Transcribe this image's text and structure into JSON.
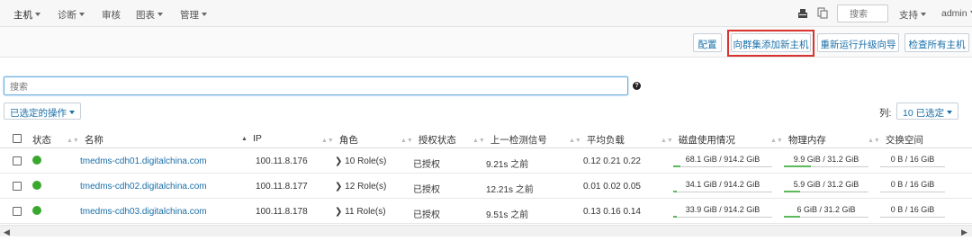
{
  "nav": {
    "items": [
      {
        "label": "主机",
        "dropdown": true
      },
      {
        "label": "诊断",
        "dropdown": true
      },
      {
        "label": "审核",
        "dropdown": false
      },
      {
        "label": "图表",
        "dropdown": true
      },
      {
        "label": "管理",
        "dropdown": true
      }
    ],
    "search_placeholder": "搜索",
    "support_label": "支持",
    "user_label": "admin"
  },
  "toolbar": {
    "config_label": "配置",
    "add_hosts_label": "向群集添加新主机",
    "upgrade_wizard_label": "重新运行升级向导",
    "inspect_label": "检查所有主机"
  },
  "filter": {
    "placeholder": "搜索"
  },
  "actions": {
    "selected_label": "已选定的操作",
    "columns_label": "列:",
    "columns_value": "10 已选定"
  },
  "table": {
    "headers": [
      "状态",
      "名称",
      "IP",
      "角色",
      "授权状态",
      "上一检测信号",
      "平均负载",
      "磁盘使用情况",
      "物理内存",
      "交换空间"
    ],
    "rows": [
      {
        "status": "good",
        "name": "tmedms-cdh01.digitalchina.com",
        "ip": "100.11.8.176",
        "roles": "10 Role(s)",
        "license": "已授权",
        "heartbeat": "9.21s 之前",
        "load": "0.12  0.21  0.22",
        "disk": "68.1 GiB / 914.2 GiB",
        "disk_frac": 0.074,
        "memory": "9.9 GiB / 31.2 GiB",
        "memory_frac": 0.317,
        "swap": "0 B / 16 GiB",
        "swap_frac": 0
      },
      {
        "status": "good",
        "name": "tmedms-cdh02.digitalchina.com",
        "ip": "100.11.8.177",
        "roles": "12 Role(s)",
        "license": "已授权",
        "heartbeat": "12.21s 之前",
        "load": "0.01  0.02  0.05",
        "disk": "34.1 GiB / 914.2 GiB",
        "disk_frac": 0.037,
        "memory": "5.9 GiB / 31.2 GiB",
        "memory_frac": 0.189,
        "swap": "0 B / 16 GiB",
        "swap_frac": 0
      },
      {
        "status": "good",
        "name": "tmedms-cdh03.digitalchina.com",
        "ip": "100.11.8.178",
        "roles": "11 Role(s)",
        "license": "已授权",
        "heartbeat": "9.51s 之前",
        "load": "0.13  0.16  0.14",
        "disk": "33.9 GiB / 914.2 GiB",
        "disk_frac": 0.037,
        "memory": "6 GiB / 31.2 GiB",
        "memory_frac": 0.192,
        "swap": "0 B / 16 GiB",
        "swap_frac": 0
      }
    ]
  },
  "colors": {
    "accent": "#1a6fa8",
    "status_good": "#3aa82f",
    "highlight": "#d9322f",
    "bar_fill": "#5cb85c"
  }
}
